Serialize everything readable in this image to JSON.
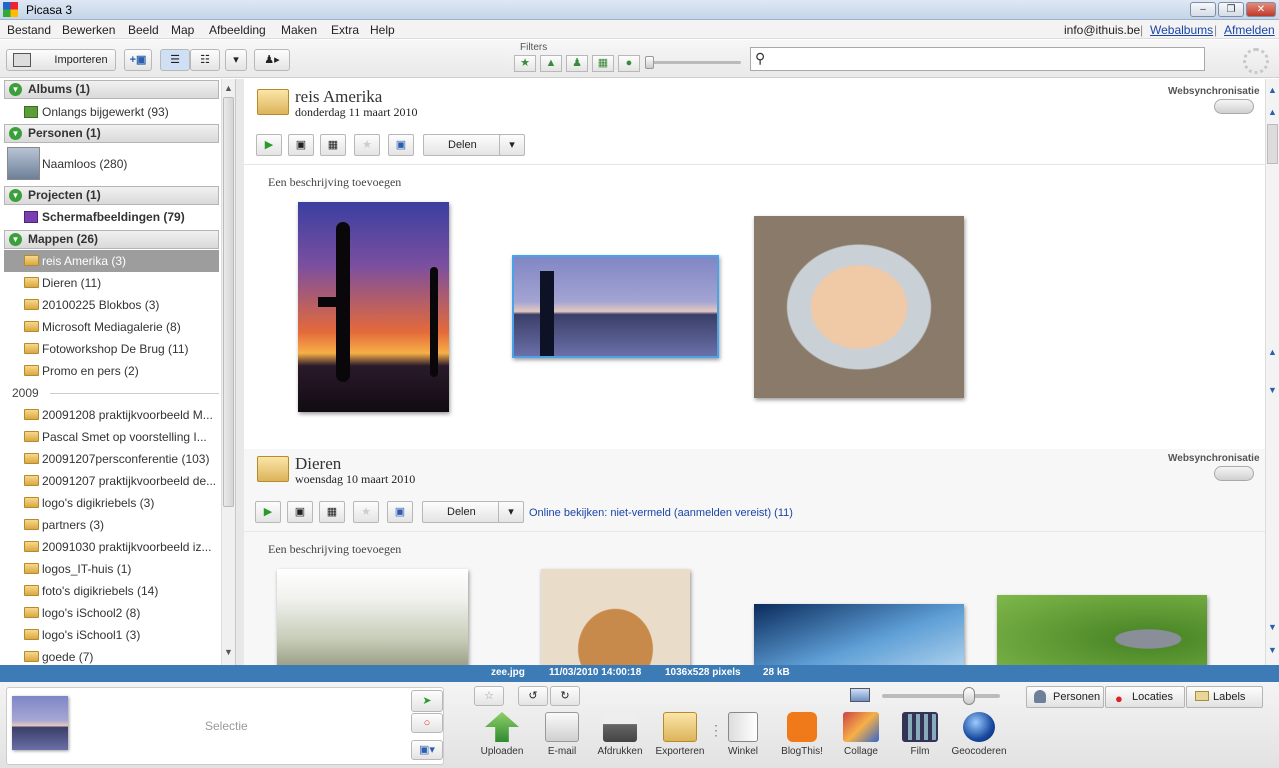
{
  "window": {
    "title": "Picasa 3"
  },
  "menu": {
    "items": [
      "Bestand",
      "Bewerken",
      "Beeld",
      "Map",
      "Afbeelding",
      "Maken",
      "Extra",
      "Help"
    ],
    "account": "info@ithuis.be",
    "webalbums": "Webalbums",
    "logout": "Afmelden"
  },
  "toolbar": {
    "import": "Importeren",
    "filters": "Filters",
    "search_placeholder": ""
  },
  "sidebar": {
    "albums": {
      "header": "Albums (1)",
      "items": [
        "Onlangs bijgewerkt (93)"
      ]
    },
    "people": {
      "header": "Personen (1)",
      "items": [
        "Naamloos (280)"
      ]
    },
    "projects": {
      "header": "Projecten (1)",
      "items": [
        "Schermafbeeldingen (79)"
      ]
    },
    "folders": {
      "header": "Mappen (26)",
      "items": [
        "reis Amerika (3)",
        "Dieren (11)",
        "20100225 Blokbos (3)",
        "Microsoft Mediagalerie (8)",
        "Fotoworkshop De Brug (11)",
        "Promo en pers (2)"
      ],
      "year": "2009",
      "items2009": [
        "20091208 praktijkvoorbeeld M...",
        "Pascal Smet op voorstelling I...",
        "20091207persconferentie (103)",
        "20091207 praktijkvoorbeeld de...",
        "logo's digikriebels (3)",
        "partners (3)",
        "20091030 praktijkvoorbeeld iz...",
        "logos_IT-huis (1)",
        "foto's digikriebels (14)",
        "logo's iSchool2 (8)",
        "logo's iSchool1 (3)",
        "goede (7)"
      ]
    }
  },
  "albums": [
    {
      "title": "reis Amerika",
      "date": "donderdag 11 maart 2010",
      "websync": "Websynchronisatie",
      "share": "Delen",
      "online": "",
      "description": "Een beschrijving toevoegen"
    },
    {
      "title": "Dieren",
      "date": "woensdag 10 maart 2010",
      "websync": "Websynchronisatie",
      "share": "Delen",
      "online": "Online bekijken: niet-vermeld (aanmelden vereist) (11)",
      "description": "Een beschrijving toevoegen"
    }
  ],
  "status": {
    "file": "zee.jpg",
    "datetime": "11/03/2010 14:00:18",
    "dimensions": "1036x528 pixels",
    "size": "28 kB"
  },
  "tray": {
    "selection": "Selectie",
    "tools": [
      "Uploaden",
      "E-mail",
      "Afdrukken",
      "Exporteren",
      "Winkel",
      "BlogThis!",
      "Collage",
      "Film",
      "Geocoderen"
    ],
    "tabs": [
      "Personen",
      "Locaties",
      "Labels"
    ]
  },
  "colors": {
    "statusbar": "#3c7bb5",
    "selected_row": "#9d9d9d",
    "section_icon": "#3ba03b",
    "link": "#1a45a8"
  }
}
